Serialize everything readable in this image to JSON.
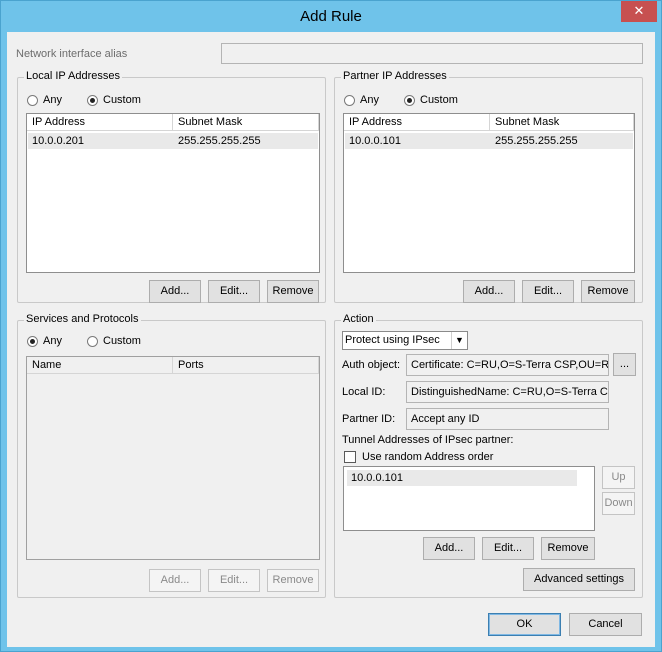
{
  "title": "Add Rule",
  "close_glyph": "✕",
  "network_alias": {
    "label": "Network interface alias",
    "value": ""
  },
  "local": {
    "title": "Local IP Addresses",
    "radio_any": "Any",
    "radio_custom": "Custom",
    "selected": "custom",
    "columns": [
      "IP Address",
      "Subnet Mask"
    ],
    "rows": [
      {
        "ip": "10.0.0.201",
        "mask": "255.255.255.255"
      }
    ],
    "buttons": {
      "add": "Add...",
      "edit": "Edit...",
      "remove": "Remove"
    }
  },
  "partner": {
    "title": "Partner IP Addresses",
    "radio_any": "Any",
    "radio_custom": "Custom",
    "selected": "custom",
    "columns": [
      "IP Address",
      "Subnet Mask"
    ],
    "rows": [
      {
        "ip": "10.0.0.101",
        "mask": "255.255.255.255"
      }
    ],
    "buttons": {
      "add": "Add...",
      "edit": "Edit...",
      "remove": "Remove"
    }
  },
  "services": {
    "title": "Services and Protocols",
    "radio_any": "Any",
    "radio_custom": "Custom",
    "selected": "any",
    "columns": [
      "Name",
      "Ports"
    ],
    "buttons": {
      "add": "Add...",
      "edit": "Edit...",
      "remove": "Remove"
    }
  },
  "action": {
    "title": "Action",
    "mode": "Protect using IPsec",
    "auth_label": "Auth object:",
    "auth_value": "Certificate: C=RU,O=S-Terra CSP,OU=R",
    "browse": "...",
    "local_id_label": "Local ID:",
    "local_id_value": "DistinguishedName: C=RU,O=S-Terra CS",
    "partner_id_label": "Partner ID:",
    "partner_id_value": "Accept any ID",
    "tunnel_label": "Tunnel Addresses of IPsec partner:",
    "random_order_label": "Use random Address order",
    "random_order_checked": false,
    "tunnel_addresses": [
      "10.0.0.101"
    ],
    "up": "Up",
    "down": "Down",
    "buttons": {
      "add": "Add...",
      "edit": "Edit...",
      "remove": "Remove"
    },
    "advanced": "Advanced settings"
  },
  "footer": {
    "ok": "OK",
    "cancel": "Cancel"
  }
}
